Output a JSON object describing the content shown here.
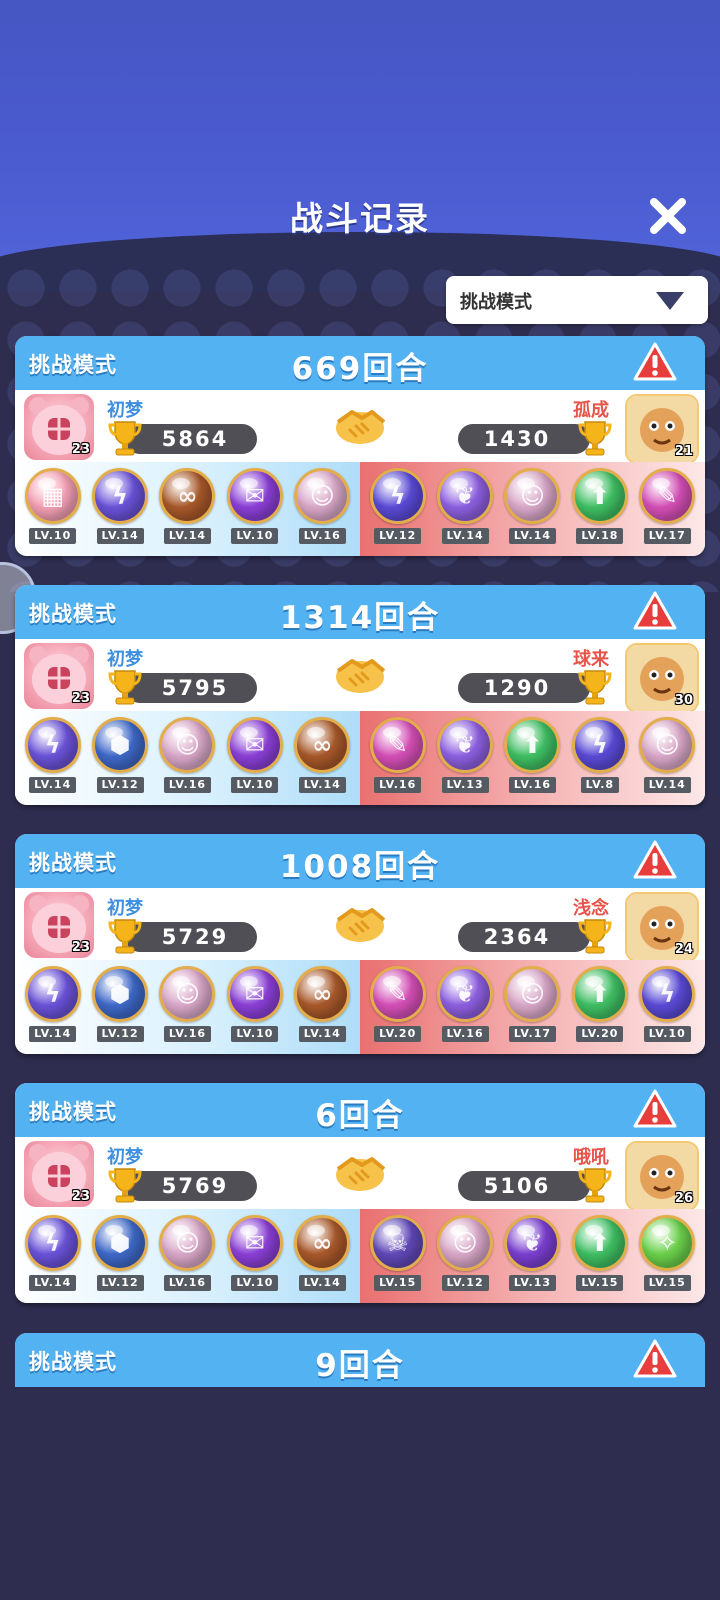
{
  "header": {
    "title": "战斗记录"
  },
  "filter": {
    "label": "挑战模式"
  },
  "records": [
    {
      "mode": "挑战模式",
      "rounds": "669回合",
      "me": {
        "name": "初梦",
        "score": "5864",
        "level": "23"
      },
      "opp": {
        "name": "孤成",
        "score": "1430",
        "level": "21"
      },
      "my_pets": [
        {
          "lv": "LV.10",
          "color": "#f4a0b4",
          "glyph": "▦"
        },
        {
          "lv": "LV.14",
          "color": "#6a52d8",
          "glyph": "ϟ"
        },
        {
          "lv": "LV.14",
          "color": "#a8582a",
          "glyph": "∞"
        },
        {
          "lv": "LV.10",
          "color": "#8a3fd6",
          "glyph": "✉"
        },
        {
          "lv": "LV.16",
          "color": "#d9a7c8",
          "glyph": "☺"
        }
      ],
      "opp_pets": [
        {
          "lv": "LV.12",
          "color": "#5a4ad6",
          "glyph": "ϟ"
        },
        {
          "lv": "LV.14",
          "color": "#8d5fe0",
          "glyph": "❦"
        },
        {
          "lv": "LV.14",
          "color": "#d9a7c8",
          "glyph": "☺"
        },
        {
          "lv": "LV.18",
          "color": "#3fbf63",
          "glyph": "⬆"
        },
        {
          "lv": "LV.17",
          "color": "#d44fb6",
          "glyph": "✎"
        }
      ]
    },
    {
      "mode": "挑战模式",
      "rounds": "1314回合",
      "me": {
        "name": "初梦",
        "score": "5795",
        "level": "23"
      },
      "opp": {
        "name": "球来",
        "score": "1290",
        "level": "30"
      },
      "my_pets": [
        {
          "lv": "LV.14",
          "color": "#6a52d8",
          "glyph": "ϟ"
        },
        {
          "lv": "LV.12",
          "color": "#3e68c8",
          "glyph": "⬢"
        },
        {
          "lv": "LV.16",
          "color": "#d9a7c8",
          "glyph": "☺"
        },
        {
          "lv": "LV.10",
          "color": "#8a3fd6",
          "glyph": "✉"
        },
        {
          "lv": "LV.14",
          "color": "#a8582a",
          "glyph": "∞"
        }
      ],
      "opp_pets": [
        {
          "lv": "LV.16",
          "color": "#d44fb6",
          "glyph": "✎"
        },
        {
          "lv": "LV.13",
          "color": "#8d5fe0",
          "glyph": "❦"
        },
        {
          "lv": "LV.16",
          "color": "#3fbf63",
          "glyph": "⬆"
        },
        {
          "lv": "LV.8",
          "color": "#5a4ad6",
          "glyph": "ϟ"
        },
        {
          "lv": "LV.14",
          "color": "#d9a7c8",
          "glyph": "☺"
        }
      ]
    },
    {
      "mode": "挑战模式",
      "rounds": "1008回合",
      "me": {
        "name": "初梦",
        "score": "5729",
        "level": "23"
      },
      "opp": {
        "name": "浅念",
        "score": "2364",
        "level": "24"
      },
      "my_pets": [
        {
          "lv": "LV.14",
          "color": "#6a52d8",
          "glyph": "ϟ"
        },
        {
          "lv": "LV.12",
          "color": "#3e68c8",
          "glyph": "⬢"
        },
        {
          "lv": "LV.16",
          "color": "#d9a7c8",
          "glyph": "☺"
        },
        {
          "lv": "LV.10",
          "color": "#8a3fd6",
          "glyph": "✉"
        },
        {
          "lv": "LV.14",
          "color": "#a8582a",
          "glyph": "∞"
        }
      ],
      "opp_pets": [
        {
          "lv": "LV.20",
          "color": "#d44fb6",
          "glyph": "✎"
        },
        {
          "lv": "LV.16",
          "color": "#8d5fe0",
          "glyph": "❦"
        },
        {
          "lv": "LV.17",
          "color": "#d9a7c8",
          "glyph": "☺"
        },
        {
          "lv": "LV.20",
          "color": "#3fbf63",
          "glyph": "⬆"
        },
        {
          "lv": "LV.10",
          "color": "#5a4ad6",
          "glyph": "ϟ"
        }
      ]
    },
    {
      "mode": "挑战模式",
      "rounds": "6回合",
      "me": {
        "name": "初梦",
        "score": "5769",
        "level": "23"
      },
      "opp": {
        "name": "哦吼",
        "score": "5106",
        "level": "26"
      },
      "my_pets": [
        {
          "lv": "LV.14",
          "color": "#6a52d8",
          "glyph": "ϟ"
        },
        {
          "lv": "LV.12",
          "color": "#3e68c8",
          "glyph": "⬢"
        },
        {
          "lv": "LV.16",
          "color": "#d9a7c8",
          "glyph": "☺"
        },
        {
          "lv": "LV.10",
          "color": "#8a3fd6",
          "glyph": "✉"
        },
        {
          "lv": "LV.14",
          "color": "#a8582a",
          "glyph": "∞"
        }
      ],
      "opp_pets": [
        {
          "lv": "LV.15",
          "color": "#6048b8",
          "glyph": "☠"
        },
        {
          "lv": "LV.12",
          "color": "#d9a7c8",
          "glyph": "☺"
        },
        {
          "lv": "LV.13",
          "color": "#7a3fd0",
          "glyph": "❦"
        },
        {
          "lv": "LV.15",
          "color": "#3fbf63",
          "glyph": "⬆"
        },
        {
          "lv": "LV.15",
          "color": "#6ad04a",
          "glyph": "✧"
        }
      ]
    },
    {
      "mode": "挑战模式",
      "rounds": "9回合"
    }
  ]
}
